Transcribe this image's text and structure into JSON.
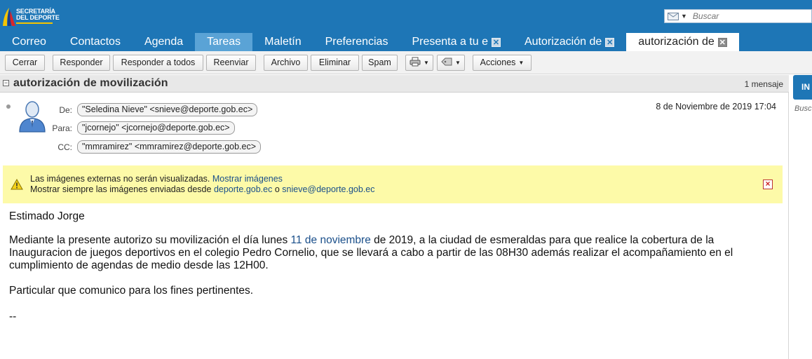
{
  "logo": {
    "line1": "SECRETARÍA",
    "line2": "DEL DEPORTE"
  },
  "search": {
    "placeholder": "Buscar"
  },
  "tabs": [
    {
      "label": "Correo"
    },
    {
      "label": "Contactos"
    },
    {
      "label": "Agenda"
    },
    {
      "label": "Tareas"
    },
    {
      "label": "Maletín"
    },
    {
      "label": "Preferencias"
    },
    {
      "label": "Presenta a tu e"
    },
    {
      "label": "Autorización de"
    },
    {
      "label": "autorización de"
    }
  ],
  "tab_close_glyph": "✕",
  "toolbar": {
    "close": "Cerrar",
    "reply": "Responder",
    "reply_all": "Responder a todos",
    "forward": "Reenviar",
    "archive": "Archivo",
    "delete": "Eliminar",
    "spam": "Spam",
    "actions": "Acciones"
  },
  "message": {
    "subject": "autorización de movilización",
    "count": "1 mensaje",
    "from_label": "De:",
    "from": "\"Seledina Nieve\" <snieve@deporte.gob.ec>",
    "to_label": "Para:",
    "to": "\"jcornejo\" <jcornejo@deporte.gob.ec>",
    "cc_label": "CC:",
    "cc": "\"mmramirez\" <mmramirez@deporte.gob.ec>",
    "date": "8 de Noviembre de 2019 17:04"
  },
  "warning": {
    "line1": "Las imágenes externas no serán visualizadas.",
    "show_images": "Mostrar imágenes",
    "line2": "Mostrar siempre las imágenes enviadas desde",
    "domain": "deporte.gob.ec",
    "or": "o",
    "sender": "snieve@deporte.gob.ec"
  },
  "body": {
    "greeting": "Estimado Jorge",
    "p1_a": "Mediante la presente autorizo su movilización el día lunes ",
    "p1_link": "11 de noviembre",
    "p1_b": " de 2019, a la ciudad de esmeraldas para que realice la cobertura de la",
    "p1_line2": "Inauguracion de juegos deportivos en el colegio Pedro Cornelio, que se llevará a cabo a partir de las 08H30 además  realizar el acompañamiento en el",
    "p1_line3": "cumplimiento de agendas de medio desde las 12H00.",
    "p2": "Particular que comunico para los fines pertinentes.",
    "signature": "--"
  },
  "right_panel": {
    "button": "IN",
    "hint": "Busc"
  },
  "colors": {
    "brand_blue": "#1e76b6",
    "warning_bg": "#fdfaa8",
    "link": "#1a4f8a"
  }
}
